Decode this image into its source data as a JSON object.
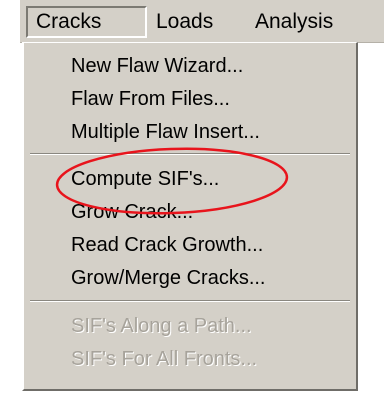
{
  "menubar": {
    "items": [
      {
        "label": "Cracks"
      },
      {
        "label": "Loads"
      },
      {
        "label": "Analysis"
      }
    ]
  },
  "menu": {
    "groups": [
      [
        {
          "label": "New Flaw Wizard...",
          "enabled": true
        },
        {
          "label": "Flaw From Files...",
          "enabled": true
        },
        {
          "label": "Multiple Flaw Insert...",
          "enabled": true
        }
      ],
      [
        {
          "label": "Compute SIF's...",
          "enabled": true,
          "highlighted": true
        },
        {
          "label": "Grow Crack...",
          "enabled": true
        },
        {
          "label": "Read Crack Growth...",
          "enabled": true
        },
        {
          "label": "Grow/Merge Cracks...",
          "enabled": true
        }
      ],
      [
        {
          "label": "SIF's Along a Path...",
          "enabled": false
        },
        {
          "label": "SIF's For All Fronts...",
          "enabled": false
        }
      ]
    ]
  },
  "annotation": {
    "color": "#e8141c"
  },
  "colors": {
    "menu_bg": "#d4d0c8",
    "disabled_text": "#a7a39b"
  }
}
